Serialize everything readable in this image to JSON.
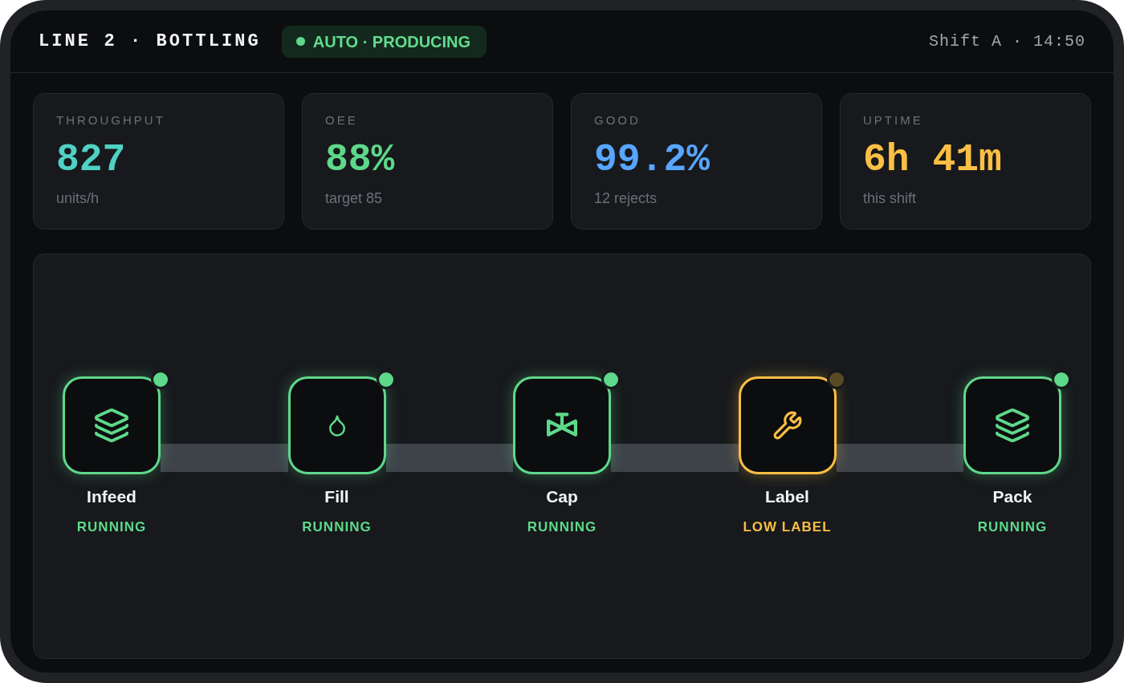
{
  "header": {
    "title": "LINE 2 · BOTTLING",
    "mode_badge": {
      "label": "AUTO · PRODUCING"
    },
    "shift_time": "Shift A · 14:50"
  },
  "kpis": [
    {
      "label": "THROUGHPUT",
      "value": "827",
      "sub": "units/h",
      "color": "#4fd1c5"
    },
    {
      "label": "OEE",
      "value": "88%",
      "sub": "target 85",
      "color": "#5ed88a"
    },
    {
      "label": "GOOD",
      "value": "99.2%",
      "sub": "12 rejects",
      "color": "#58a6ff"
    },
    {
      "label": "UPTIME",
      "value": "6h 41m",
      "sub": "this shift",
      "color": "#fbbf44"
    }
  ],
  "stations": [
    {
      "name": "Infeed",
      "status": "RUNNING",
      "kind": "ok",
      "indicator_on": true
    },
    {
      "name": "Fill",
      "status": "RUNNING",
      "kind": "ok",
      "indicator_on": true
    },
    {
      "name": "Cap",
      "status": "RUNNING",
      "kind": "ok",
      "indicator_on": true
    },
    {
      "name": "Label",
      "status": "LOW LABEL",
      "kind": "alert",
      "indicator_on": false
    },
    {
      "name": "Pack",
      "status": "RUNNING",
      "kind": "ok",
      "indicator_on": true
    }
  ]
}
